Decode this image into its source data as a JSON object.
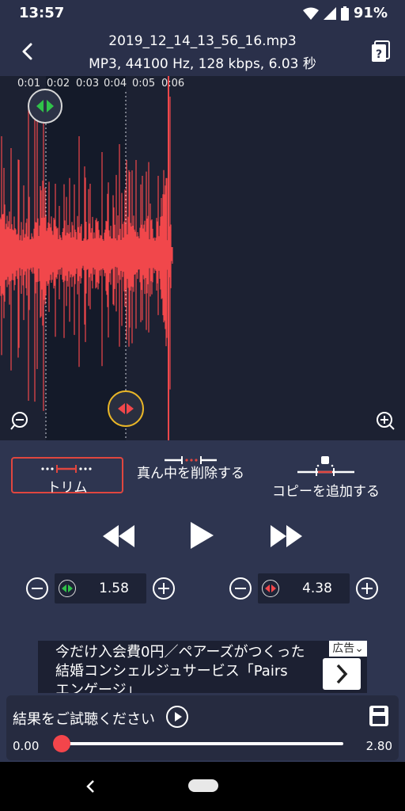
{
  "status": {
    "time": "13:57",
    "battery": "91%"
  },
  "header": {
    "title": "2019_12_14_13_56_16.mp3",
    "subtitle": "MP3, 44100 Hz, 128 kbps, 6.03 秒"
  },
  "timeline": {
    "ticks": [
      "0:01",
      "0:02",
      "0:03",
      "0:04",
      "0:05",
      "0:06"
    ]
  },
  "selection": {
    "start_seconds": 1.58,
    "end_seconds": 4.38,
    "duration_seconds": 6.03
  },
  "modes": {
    "trim": "トリム",
    "remove_middle": "真ん中を削除する",
    "add_copy": "コピーを追加する",
    "active": "trim"
  },
  "start_control": {
    "value": "1.58"
  },
  "end_control": {
    "value": "4.38"
  },
  "ad": {
    "line1": "今だけ入会費0円／ペアーズがつくった",
    "line2": "結婚コンシェルジュサービス「Pairs",
    "line3": "エンゲージ」",
    "badge": "広告"
  },
  "preview": {
    "label": "結果をご試聴ください",
    "current": "0.00",
    "total": "2.80",
    "progress": 0
  },
  "colors": {
    "waveform": "#f1474b",
    "accent_red": "#e0463f",
    "start_handle": "#30c24a",
    "end_handle_ring": "#e9b627"
  },
  "icons": {
    "back": "chevron-left-icon",
    "doc": "document-info-icon",
    "zoom_out": "zoom-out-icon",
    "zoom_in": "zoom-in-icon",
    "rewind": "rewind-icon",
    "play": "play-icon",
    "forward": "fast-forward-icon",
    "save": "save-icon"
  }
}
